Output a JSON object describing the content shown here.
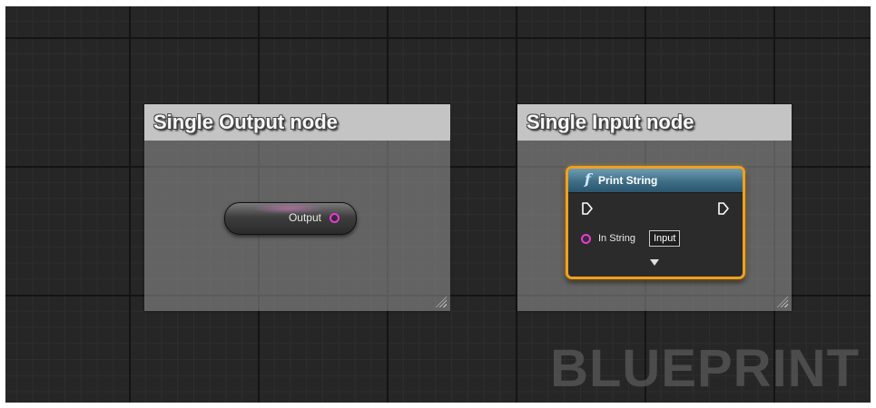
{
  "comments": {
    "output": {
      "title": "Single Output node"
    },
    "input": {
      "title": "Single Input node"
    }
  },
  "output_node": {
    "label": "Output",
    "pin_icon": "data-pin-ring-icon"
  },
  "print_node": {
    "icon_text": "f",
    "title": "Print String",
    "in_string_label": "In String",
    "input_value": "Input",
    "pin_color": "#e63cd2",
    "border_color": "#f0a020",
    "header_color": "#3e6e86"
  },
  "watermark": "BLUEPRINT"
}
